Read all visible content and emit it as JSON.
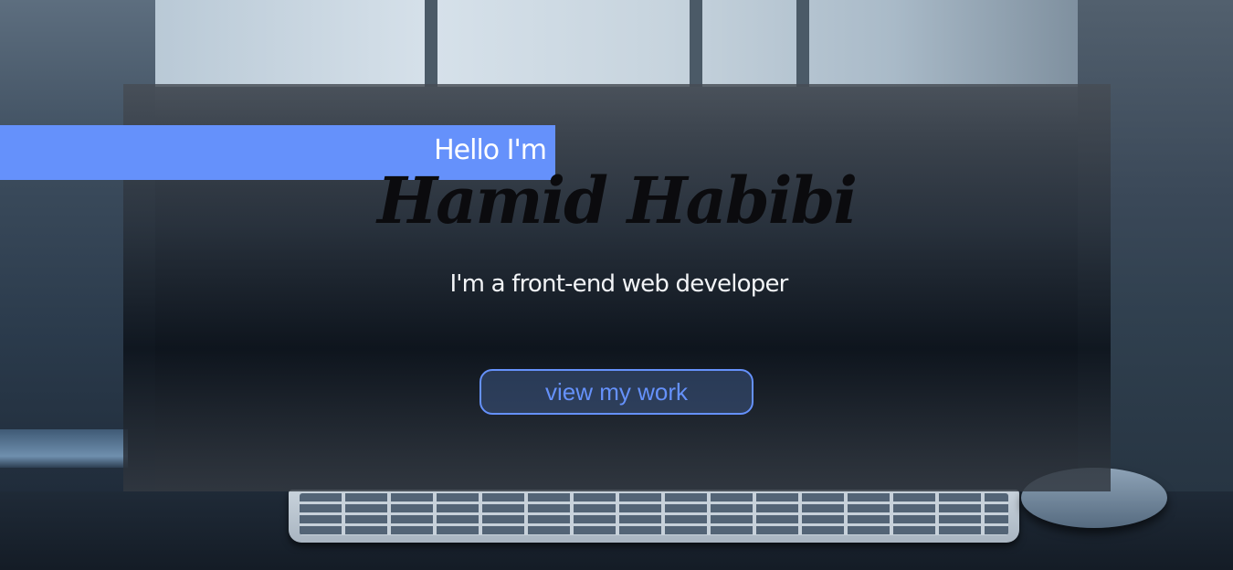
{
  "hero": {
    "greeting": "Hello I'm",
    "name": "Hamid Habibi",
    "tagline": "I'm a front-end web developer",
    "cta_label": "view my work"
  },
  "colors": {
    "accent": "#6591fb",
    "name_text": "#0b0b0e",
    "tagline_text": "#f2f4f7"
  }
}
